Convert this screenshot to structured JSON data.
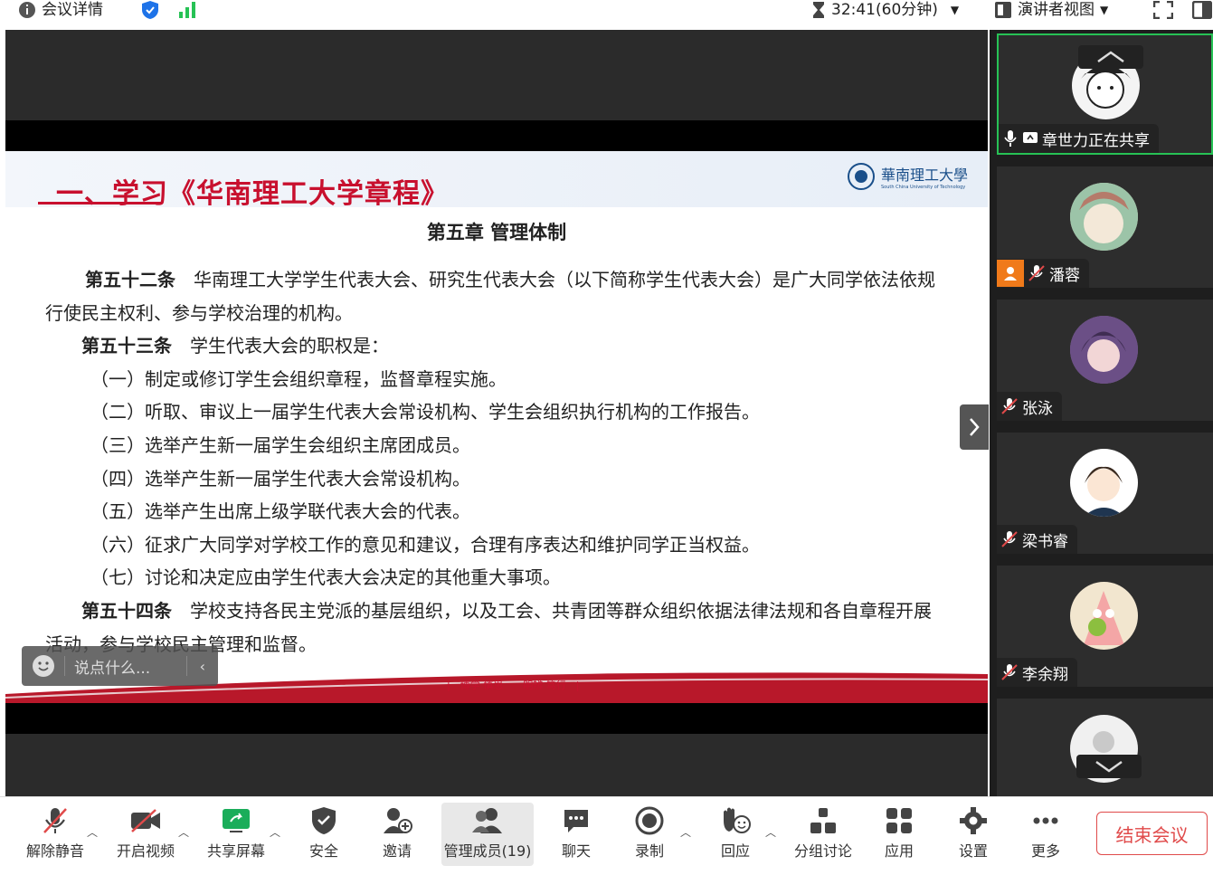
{
  "topbar": {
    "meeting_info": "会议详情",
    "timer": "32:41(60分钟)",
    "view_mode": "演讲者视图"
  },
  "slide": {
    "title": "一、学习《华南理工大学章程》",
    "logo_text": "華南理工大學",
    "logo_sub": "South China University of Technology",
    "chapter": "第五章  管理体制",
    "a52_label": "第五十二条",
    "a52_text": "　华南理工大学学生代表大会、研究生代表大会（以下简称学生代表大会）是广大同学依法依规行使民主权利、参与学校治理的机构。",
    "a53_label": "第五十三条",
    "a53_text": "　学生代表大会的职权是：",
    "items": [
      "（一）制定或修订学生会组织章程，监督章程实施。",
      "（二）听取、审议上一届学生代表大会常设机构、学生会组织执行机构的工作报告。",
      "（三）选举产生新一届学生会组织主席团成员。",
      "（四）选举产生新一届学生代表大会常设机构。",
      "（五）选举产生出席上级学联代表大会的代表。",
      "（六）征求广大同学对学校工作的意见和建议，合理有序表达和维护同学正当权益。",
      "（七）讨论和决定应由学生代表大会决定的其他重大事项。"
    ],
    "a54_label": "第五十四条",
    "a54_text": "　学校支持各民主党派的基层组织，以及工会、共青团等群众组织依据法律法规和各自章程开展活动，参与学校民主管理和监督。",
    "motto": "|　博学 慎思　　明辨 笃行　|"
  },
  "chat": {
    "placeholder": "说点什么..."
  },
  "participants": [
    {
      "name": "章世力正在共享",
      "active": true
    },
    {
      "name": "潘蓉",
      "host": true
    },
    {
      "name": "张泳"
    },
    {
      "name": "梁书睿"
    },
    {
      "name": "李余翔"
    }
  ],
  "toolbar": {
    "mute": "解除静音",
    "video": "开启视频",
    "share": "共享屏幕",
    "security": "安全",
    "invite": "邀请",
    "members": "管理成员(19)",
    "chat": "聊天",
    "record": "录制",
    "react": "回应",
    "breakout": "分组讨论",
    "apps": "应用",
    "settings": "设置",
    "more": "更多",
    "end": "结束会议"
  },
  "colors": {
    "accent_red": "#c8102e",
    "active_green": "#27c255",
    "share_green": "#1aad5a",
    "end_red": "#e04a4a"
  }
}
